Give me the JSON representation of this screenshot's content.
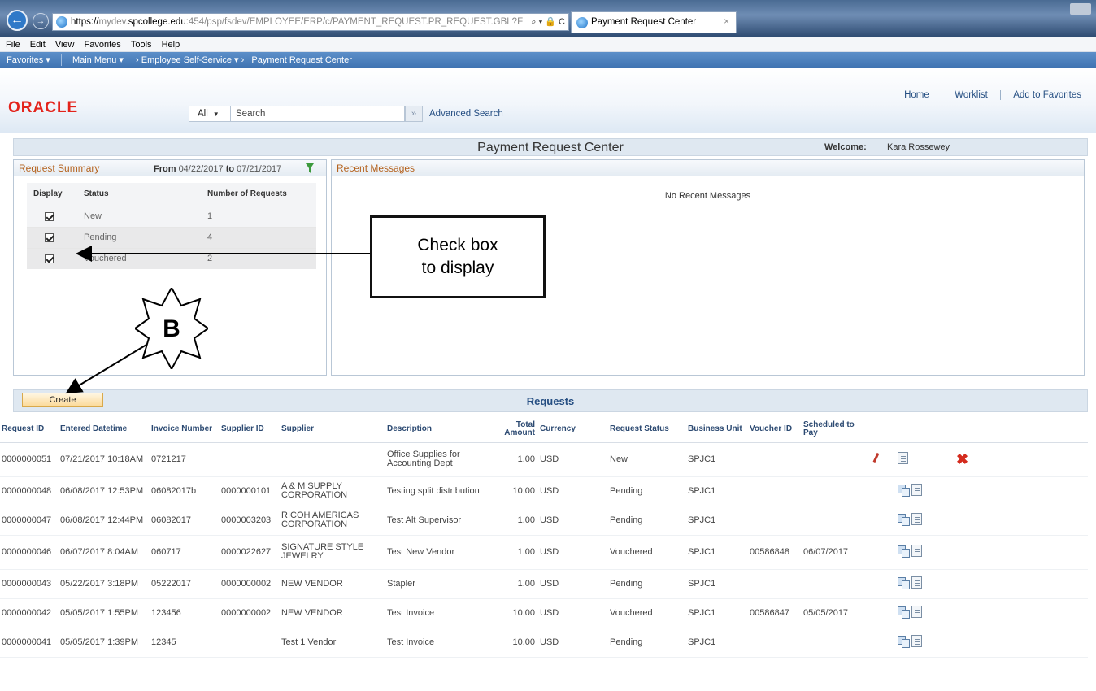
{
  "browser": {
    "url_prefix": "https://",
    "url_host_grey": "mydev.",
    "url_host": "spcollege.edu",
    "url_rest": ":454/psp/fsdev/EMPLOYEE/ERP/c/PAYMENT_REQUEST.PR_REQUEST.GBL?F",
    "url_controls": "⌕ ▾ 🔒 C",
    "tab_title": "Payment Request Center",
    "tab_close": "×"
  },
  "menu_bar": [
    "File",
    "Edit",
    "View",
    "Favorites",
    "Tools",
    "Help"
  ],
  "ps_nav": {
    "favorites": "Favorites ▾",
    "main_menu": "Main Menu ▾",
    "crumb1": "›  Employee Self-Service ▾  ›",
    "crumb2": "Payment Request Center"
  },
  "header": {
    "logo": "ORACLE",
    "home": "Home",
    "worklist": "Worklist",
    "add_to_favorites": "Add to Favorites",
    "search_scope": "All",
    "search_placeholder": "Search",
    "search_go": "»",
    "advanced_search": "Advanced Search"
  },
  "page": {
    "title": "Payment Request Center",
    "welcome_label": "Welcome:",
    "welcome_name": "Kara Rossewey"
  },
  "summary": {
    "title": "Request Summary",
    "from_label": "From",
    "from_date": "04/22/2017",
    "to_label": "to",
    "to_date": "07/21/2017",
    "col_display": "Display",
    "col_status": "Status",
    "col_count": "Number of Requests",
    "rows": [
      {
        "status": "New",
        "count": "1",
        "checked": true
      },
      {
        "status": "Pending",
        "count": "4",
        "checked": true
      },
      {
        "status": "Vouchered",
        "count": "2",
        "checked": true
      }
    ]
  },
  "messages": {
    "title": "Recent Messages",
    "empty": "No Recent Messages"
  },
  "requests": {
    "title": "Requests",
    "create_label": "Create",
    "columns": {
      "request_id": "Request ID",
      "entered": "Entered Datetime",
      "invoice": "Invoice Number",
      "supplier_id": "Supplier ID",
      "supplier": "Supplier",
      "description": "Description",
      "total_amount_1": "Total",
      "total_amount_2": "Amount",
      "currency": "Currency",
      "status": "Request Status",
      "bu": "Business Unit",
      "voucher": "Voucher ID",
      "scheduled_1": "Scheduled to",
      "scheduled_2": "Pay"
    },
    "rows": [
      {
        "id": "0000000051",
        "entered": "07/21/2017 10:18AM",
        "invoice": "0721217",
        "supplier_id": "",
        "supplier_1": "",
        "supplier_2": "",
        "desc_1": "Office Supplies for",
        "desc_2": "Accounting Dept",
        "amount": "1.00",
        "currency": "USD",
        "status": "New",
        "bu": "SPJC1",
        "voucher": "",
        "scheduled": ""
      },
      {
        "id": "0000000048",
        "entered": "06/08/2017 12:53PM",
        "invoice": "06082017b",
        "supplier_id": "0000000101",
        "supplier_1": "A & M SUPPLY",
        "supplier_2": "CORPORATION",
        "desc_1": "Testing split distribution",
        "desc_2": "",
        "amount": "10.00",
        "currency": "USD",
        "status": "Pending",
        "bu": "SPJC1",
        "voucher": "",
        "scheduled": ""
      },
      {
        "id": "0000000047",
        "entered": "06/08/2017 12:44PM",
        "invoice": "06082017",
        "supplier_id": "0000003203",
        "supplier_1": "RICOH AMERICAS",
        "supplier_2": "CORPORATION",
        "desc_1": "Test Alt Supervisor",
        "desc_2": "",
        "amount": "1.00",
        "currency": "USD",
        "status": "Pending",
        "bu": "SPJC1",
        "voucher": "",
        "scheduled": ""
      },
      {
        "id": "0000000046",
        "entered": "06/07/2017 8:04AM",
        "invoice": "060717",
        "supplier_id": "0000022627",
        "supplier_1": "SIGNATURE STYLE",
        "supplier_2": "JEWELRY",
        "desc_1": "Test New Vendor",
        "desc_2": "",
        "amount": "1.00",
        "currency": "USD",
        "status": "Vouchered",
        "bu": "SPJC1",
        "voucher": "00586848",
        "scheduled": "06/07/2017"
      },
      {
        "id": "0000000043",
        "entered": "05/22/2017 3:18PM",
        "invoice": "05222017",
        "supplier_id": "0000000002",
        "supplier_1": "NEW VENDOR",
        "supplier_2": "",
        "desc_1": "Stapler",
        "desc_2": "",
        "amount": "1.00",
        "currency": "USD",
        "status": "Pending",
        "bu": "SPJC1",
        "voucher": "",
        "scheduled": ""
      },
      {
        "id": "0000000042",
        "entered": "05/05/2017 1:55PM",
        "invoice": "123456",
        "supplier_id": "0000000002",
        "supplier_1": "NEW VENDOR",
        "supplier_2": "",
        "desc_1": "Test Invoice",
        "desc_2": "",
        "amount": "10.00",
        "currency": "USD",
        "status": "Vouchered",
        "bu": "SPJC1",
        "voucher": "00586847",
        "scheduled": "05/05/2017"
      },
      {
        "id": "0000000041",
        "entered": "05/05/2017 1:39PM",
        "invoice": "12345",
        "supplier_id": "",
        "supplier_1": "Test 1 Vendor",
        "supplier_2": "",
        "desc_1": "Test Invoice",
        "desc_2": "",
        "amount": "10.00",
        "currency": "USD",
        "status": "Pending",
        "bu": "SPJC1",
        "voucher": "",
        "scheduled": ""
      }
    ]
  },
  "annotations": {
    "callout_line1": "Check box",
    "callout_line2": "to display",
    "marker": "B"
  },
  "colors": {
    "oracle_red": "#e3231b",
    "panel_header_text": "#b4621e",
    "link_blue": "#264f83",
    "create_button": "#fbd998",
    "delete_red": "#d42b1e"
  }
}
